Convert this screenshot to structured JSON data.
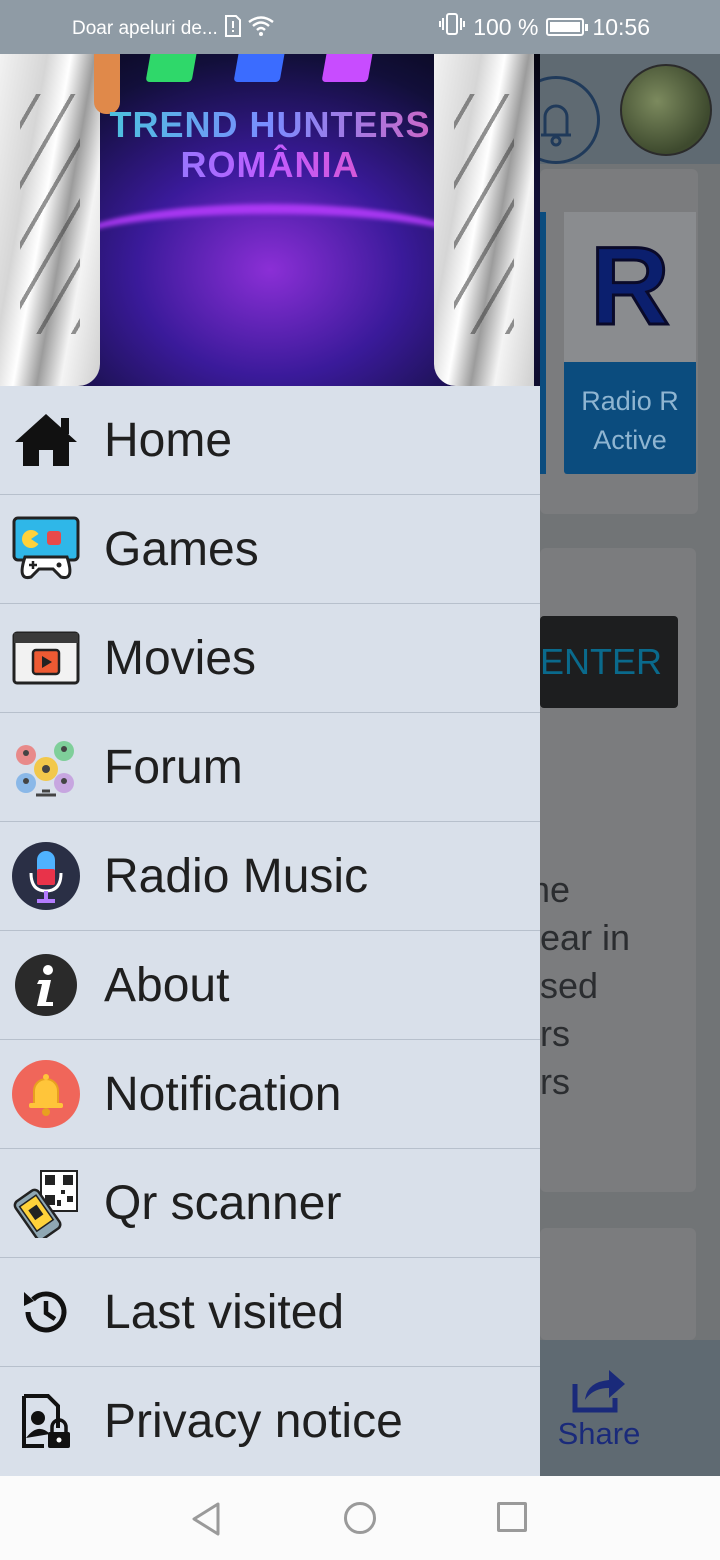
{
  "status_bar": {
    "carrier_text": "Doar apeluri de...",
    "battery_percent": "100 %",
    "time": "10:56",
    "icons": [
      "sim-alert-icon",
      "wifi-icon",
      "vibrate-icon",
      "battery-icon"
    ]
  },
  "drawer": {
    "header": {
      "title_line1": "TREND HUNTERS",
      "title_line2": "ROMÂNIA",
      "bar_colors": [
        "#2fd86a",
        "#3b6cff",
        "#c84cff"
      ]
    },
    "items": [
      {
        "label": "Home",
        "icon": "home-icon"
      },
      {
        "label": "Games",
        "icon": "games-icon"
      },
      {
        "label": "Movies",
        "icon": "movies-icon"
      },
      {
        "label": "Forum",
        "icon": "forum-icon"
      },
      {
        "label": "Radio Music",
        "icon": "microphone-icon"
      },
      {
        "label": "About",
        "icon": "info-icon"
      },
      {
        "label": "Notification",
        "icon": "bell-icon"
      },
      {
        "label": "Qr scanner",
        "icon": "qr-scanner-icon"
      },
      {
        "label": "Last visited",
        "icon": "history-icon"
      },
      {
        "label": "Privacy notice",
        "icon": "privacy-icon"
      }
    ]
  },
  "background_app": {
    "radio_tile_letter": "R",
    "radio_tile_line1": "Radio R",
    "radio_tile_line2": "Active",
    "enter_button": "ENTER",
    "text_lines": [
      " the",
      "pear in",
      "used",
      "ers",
      "ers"
    ],
    "share_label": "Share"
  },
  "colors": {
    "drawer_bg": "#d9e0ea",
    "status_bar": "#8f9ba5",
    "scrim": "#717476",
    "radio_tile": "#0b4c7e"
  }
}
